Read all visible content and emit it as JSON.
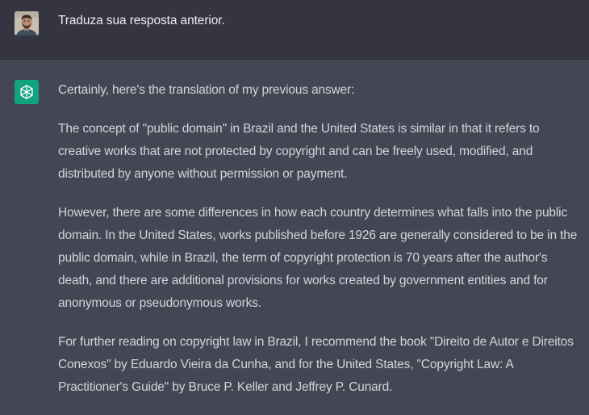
{
  "user_message": {
    "text": "Traduza sua resposta anterior."
  },
  "assistant_message": {
    "paragraphs": [
      "Certainly, here's the translation of my previous answer:",
      "The concept of \"public domain\" in Brazil and the United States is similar in that it refers to creative works that are not protected by copyright and can be freely used, modified, and distributed by anyone without permission or payment.",
      "However, there are some differences in how each country determines what falls into the public domain. In the United States, works published before 1926 are generally considered to be in the public domain, while in Brazil, the term of copyright protection is 70 years after the author's death, and there are additional provisions for works created by government entities and for anonymous or pseudonymous works.",
      "For further reading on copyright law in Brazil, I recommend the book \"Direito de Autor e Direitos Conexos\" by Eduardo Vieira da Cunha, and for the United States, \"Copyright Law: A Practitioner's Guide\" by Bruce P. Keller and Jeffrey P. Cunard."
    ]
  },
  "colors": {
    "user_bg": "#343541",
    "assistant_bg": "#444654",
    "bot_avatar": "#10a37f"
  },
  "icons": {
    "user_avatar": "user-avatar-photo",
    "bot_avatar": "openai-logo-icon"
  }
}
